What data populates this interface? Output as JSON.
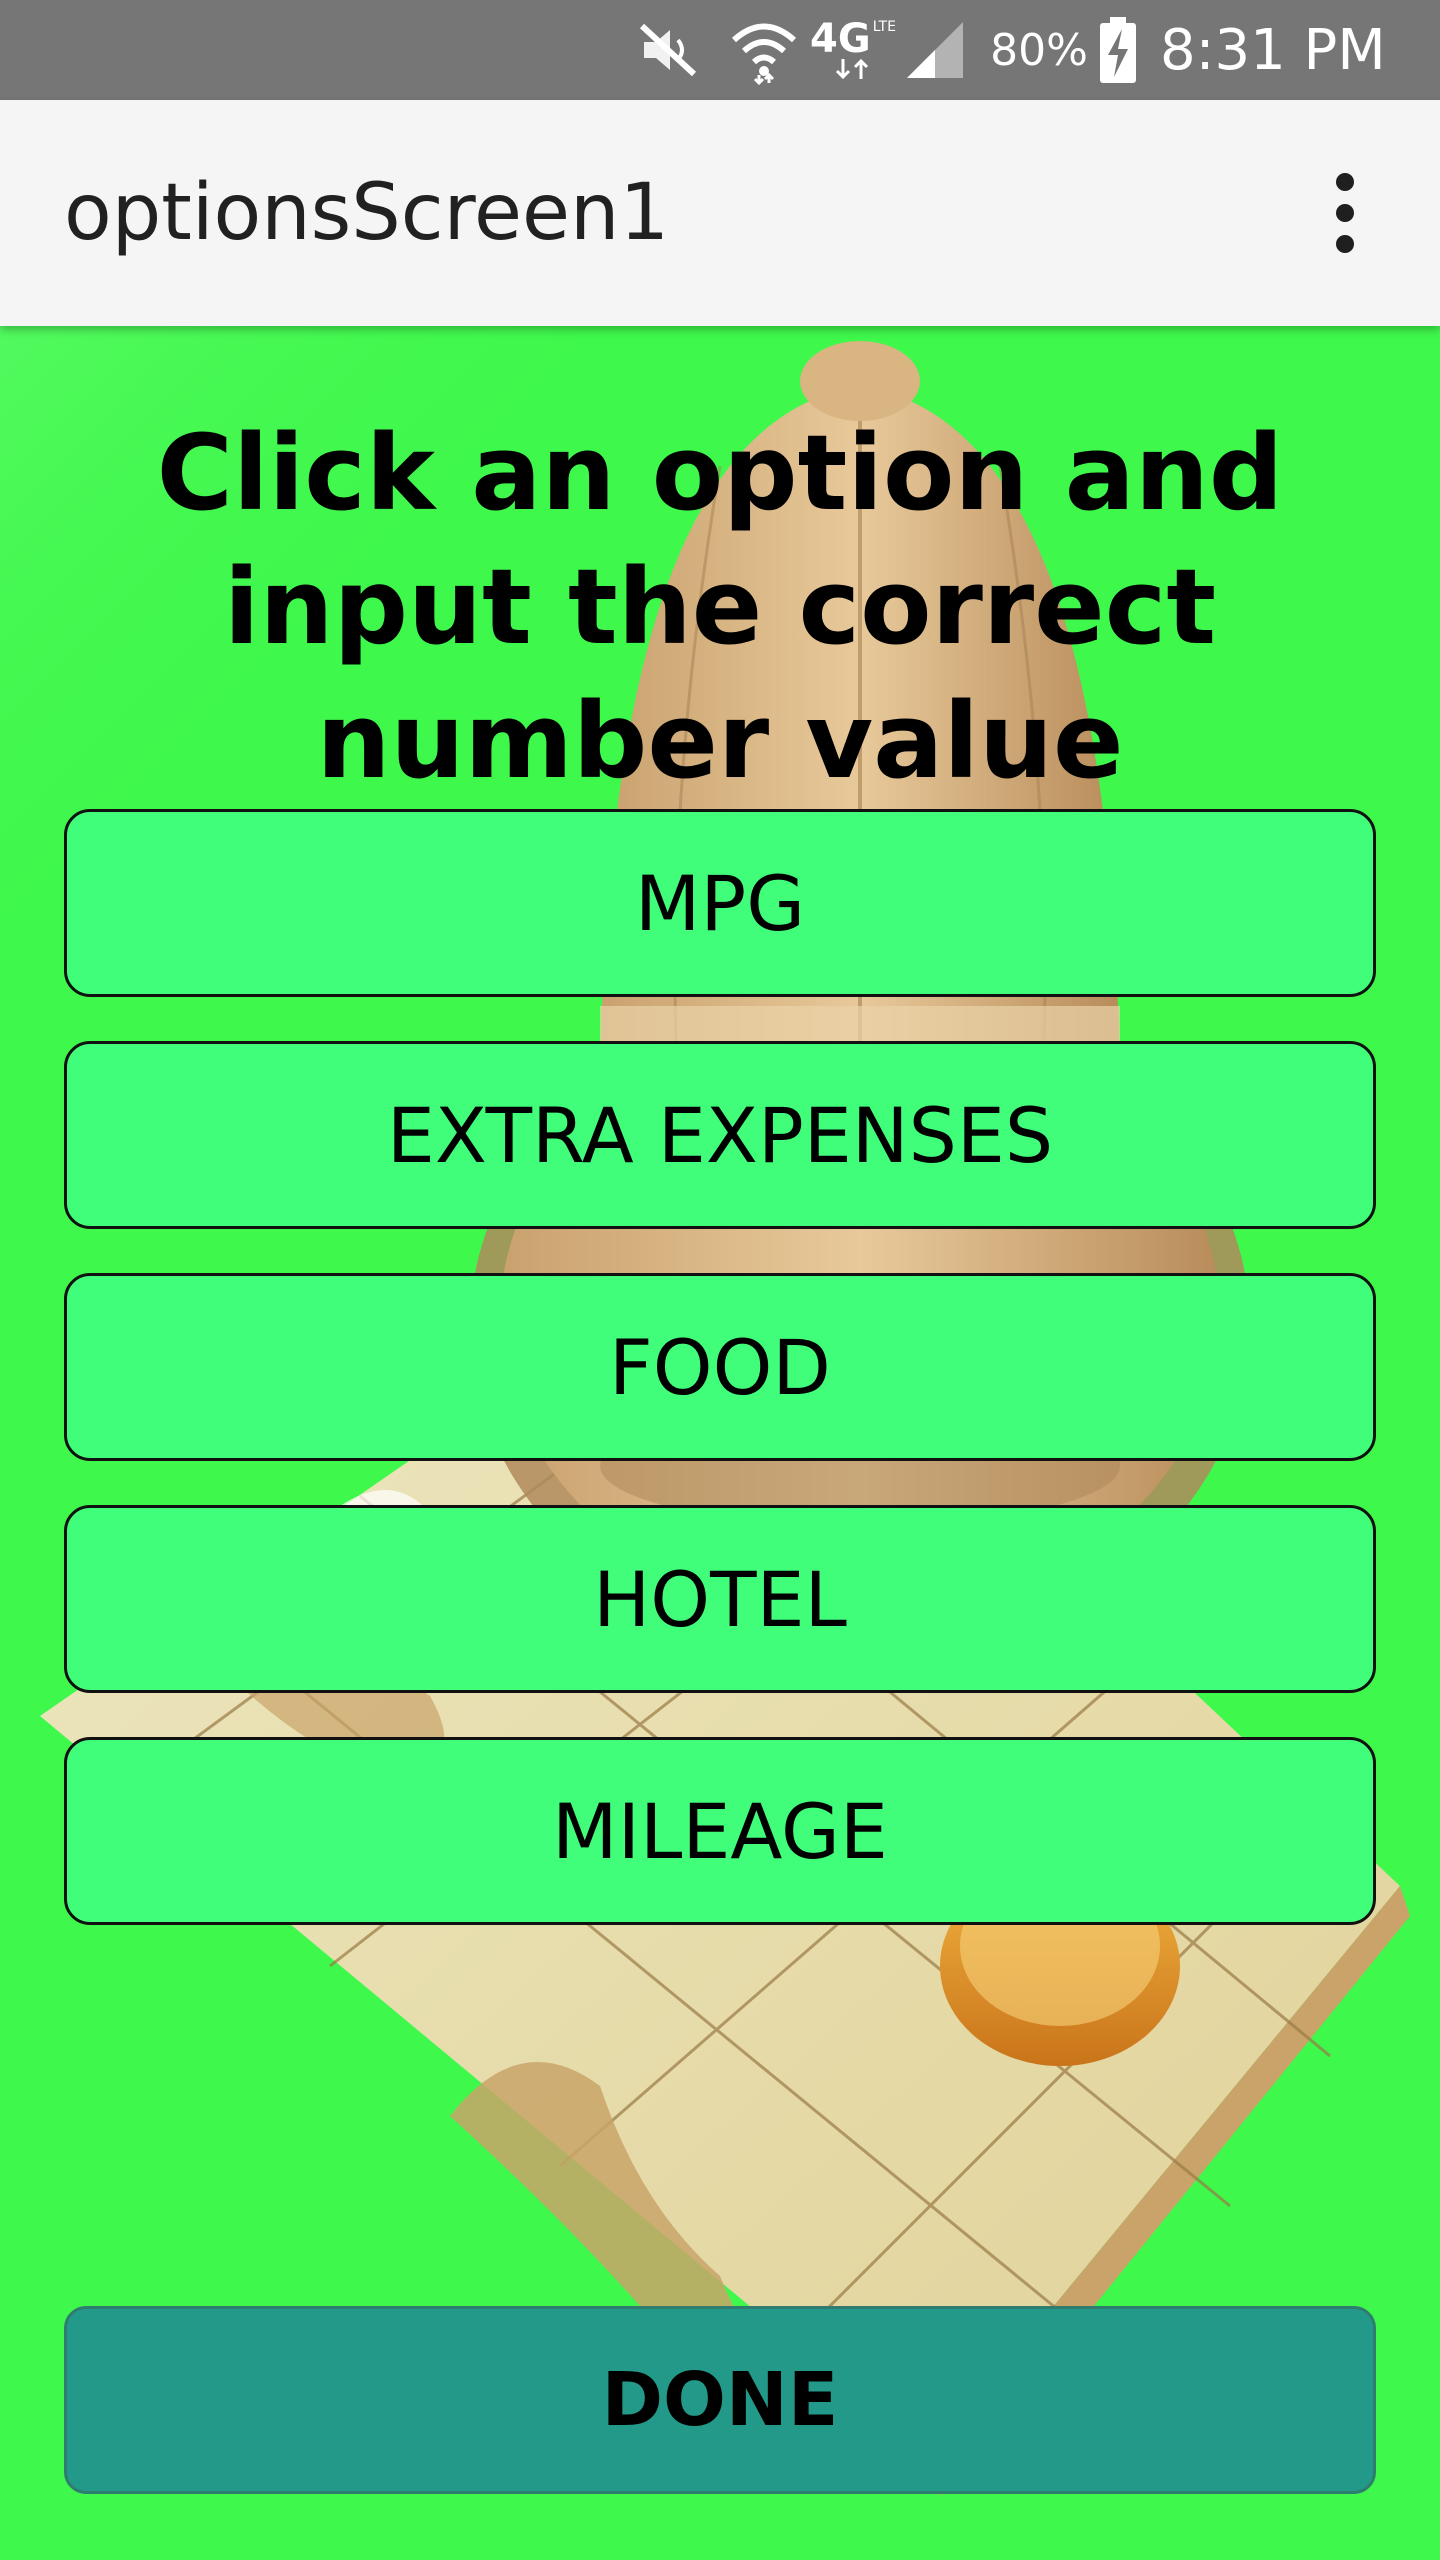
{
  "status_bar": {
    "battery_percent": "80%",
    "time": "8:31 PM",
    "network_type": "4G",
    "network_sub": "LTE",
    "icons": [
      "mute-icon",
      "wifi-icon",
      "4g-lte-icon",
      "signal-icon",
      "battery-charging-icon"
    ]
  },
  "app_bar": {
    "title": "optionsScreen1",
    "menu_icon": "more-vert-icon"
  },
  "main": {
    "instruction": "Click an option and input the correct number value",
    "options": [
      {
        "label": "MPG"
      },
      {
        "label": "EXTRA EXPENSES"
      },
      {
        "label": "FOOD"
      },
      {
        "label": "HOTEL"
      },
      {
        "label": "MILEAGE"
      }
    ],
    "done_label": "DONE"
  },
  "colors": {
    "status_bar": "#767676",
    "app_bar": "#f5f5f5",
    "background": "#3ff84c",
    "option_button": "#40fe7a",
    "done_button": "#23998a"
  }
}
